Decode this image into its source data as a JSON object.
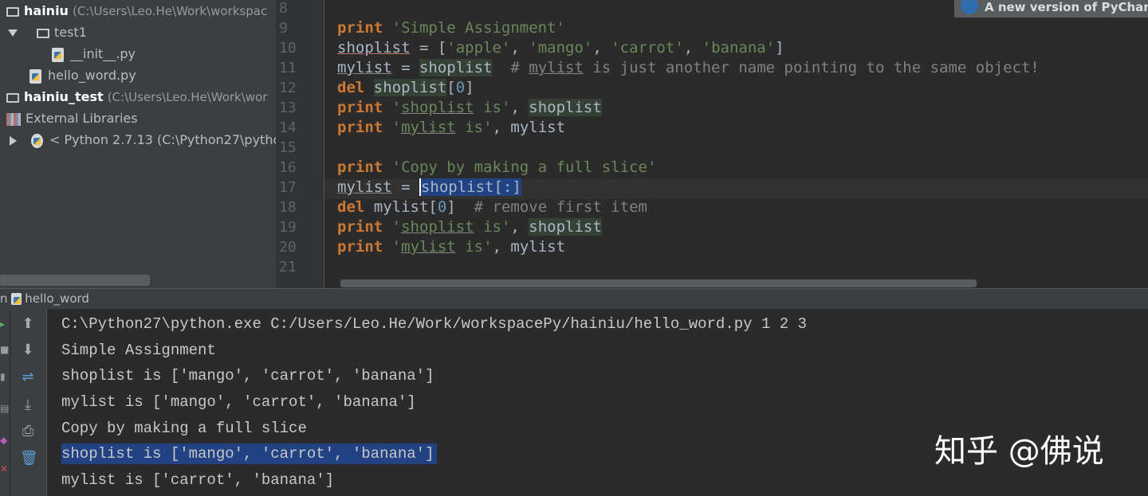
{
  "project_tree": {
    "root": {
      "name": "hainiu",
      "path": "(C:\\Users\\Leo.He\\Work\\workspac"
    },
    "folder_test1": "test1",
    "file_init": "__init__.py",
    "file_hello": "hello_word.py",
    "root2": {
      "name": "hainiu_test",
      "path": "(C:\\Users\\Leo.He\\Work\\wor"
    },
    "external_libraries": "External Libraries",
    "python_sdk": "< Python 2.7.13 (C:\\Python27\\pytho"
  },
  "editor": {
    "line_numbers": [
      "8",
      "9",
      "10",
      "11",
      "12",
      "13",
      "14",
      "15",
      "16",
      "17",
      "18",
      "19",
      "20",
      "21"
    ],
    "code": {
      "l9_kw": "print",
      "l9_str": "'Simple Assignment'",
      "l10_var": "shoplist",
      "l10_eq": " = [",
      "l10_s1": "'apple'",
      "l10_c1": ", ",
      "l10_s2": "'mango'",
      "l10_c2": ", ",
      "l10_s3": "'carrot'",
      "l10_c3": ", ",
      "l10_s4": "'banana'",
      "l10_end": "]",
      "l11_var": "mylist",
      "l11_eq": " = ",
      "l11_ref": "shoplist",
      "l11_cm1": "  # ",
      "l11_cmu": "mylist",
      "l11_cm2": " is just another name pointing to the same object!",
      "l12_kw": "del",
      "l12_sp": " ",
      "l12_ref": "shoplist",
      "l12_idx1": "[",
      "l12_num": "0",
      "l12_idx2": "]",
      "l13_kw": "print",
      "l13_sp": " ",
      "l13_q": "'",
      "l13_su": "shoplist",
      "l13_s2": " is'",
      "l13_c": ", ",
      "l13_ref": "shoplist",
      "l14_kw": "print",
      "l14_sp": " ",
      "l14_q": "'",
      "l14_su": "mylist",
      "l14_s2": " is'",
      "l14_c": ", mylist",
      "l16_kw": "print",
      "l16_str": "'Copy by making a full slice'",
      "l17_var": "mylist",
      "l17_eq": " = ",
      "l17_sel": "shoplist[:]",
      "l18_kw": "del",
      "l18_a": " mylist[",
      "l18_num": "0",
      "l18_b": "]  ",
      "l18_cm": "# remove first item",
      "l19_kw": "print",
      "l19_sp": " ",
      "l19_q": "'",
      "l19_su": "shoplist",
      "l19_s2": " is'",
      "l19_c": ", ",
      "l19_ref": "shoplist",
      "l20_kw": "print",
      "l20_sp": " ",
      "l20_q": "'",
      "l20_su": "mylist",
      "l20_s2": " is'",
      "l20_c": ", mylist"
    }
  },
  "notification": "A new version of PyCharm",
  "run_panel": {
    "tab_prefix": "n",
    "tab_label": "hello_word"
  },
  "console_lines": [
    "C:\\Python27\\python.exe C:/Users/Leo.He/Work/workspacePy/hainiu/hello_word.py 1 2 3",
    "Simple Assignment",
    "shoplist is ['mango', 'carrot', 'banana']",
    "mylist is ['mango', 'carrot', 'banana']",
    "Copy by making a full slice",
    "shoplist is ['mango', 'carrot', 'banana']",
    "mylist is ['carrot', 'banana']"
  ],
  "watermark": "知乎 @佛说",
  "colors": {
    "keyword": "#cc7832",
    "string": "#6a8759",
    "comment": "#808080",
    "selection": "#214283",
    "number": "#6897bb"
  },
  "icons": [
    "folder-icon",
    "python-file-icon",
    "external-libraries-icon",
    "python-sdk-icon",
    "up-arrow-icon",
    "down-arrow-icon",
    "soft-wrap-icon",
    "scroll-to-end-icon",
    "print-icon",
    "trash-icon",
    "info-icon"
  ]
}
